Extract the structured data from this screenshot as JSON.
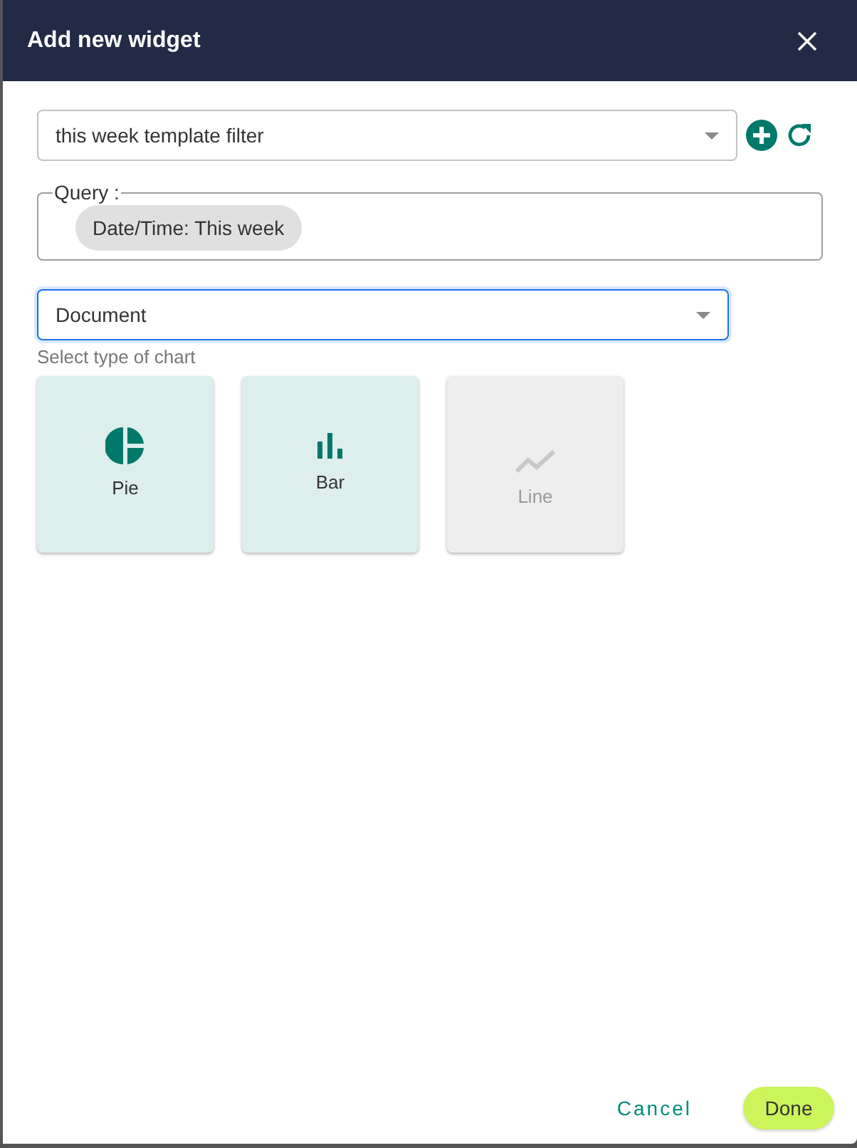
{
  "dialog": {
    "title": "Add new widget"
  },
  "template_select": {
    "value": "this week template filter",
    "focused": false
  },
  "query": {
    "legend": "Query :",
    "chips": [
      "Date/Time: This week"
    ]
  },
  "source_select": {
    "value": "Document",
    "focused": true
  },
  "chart_types": {
    "label": "Select type of chart",
    "items": [
      {
        "kind": "pie",
        "label": "Pie",
        "disabled": false
      },
      {
        "kind": "bar",
        "label": "Bar",
        "disabled": false
      },
      {
        "kind": "line",
        "label": "Line",
        "disabled": true
      }
    ]
  },
  "buttons": {
    "cancel": "Cancel",
    "done": "Done"
  }
}
